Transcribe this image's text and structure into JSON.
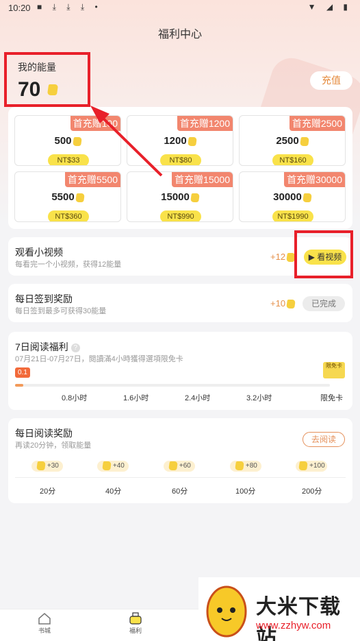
{
  "status_bar": {
    "time": "10:20",
    "left_icons": "■ ⤓ ⤓ ⤓ •",
    "right_icons": "▼ ◢ ▮"
  },
  "header": {
    "title": "福利中心"
  },
  "energy": {
    "label": "我的能量",
    "value": "70",
    "recharge_label": "充值"
  },
  "packs": [
    {
      "badge": "首充赠100",
      "amount": "500",
      "price": "NT$33"
    },
    {
      "badge": "首充赠1200",
      "amount": "1200",
      "price": "NT$80"
    },
    {
      "badge": "首充赠2500",
      "amount": "2500",
      "price": "NT$160"
    },
    {
      "badge": "首充赠5500",
      "amount": "5500",
      "price": "NT$360"
    },
    {
      "badge": "首充赠15000",
      "amount": "15000",
      "price": "NT$990"
    },
    {
      "badge": "首充赠30000",
      "amount": "30000",
      "price": "NT$1990"
    }
  ],
  "video_task": {
    "title": "观看小视频",
    "subtitle": "每看完一个小视频，获得12能量",
    "reward": "+12",
    "button": "看视频"
  },
  "checkin_task": {
    "title": "每日签到奖励",
    "subtitle": "每日签到最多可获得30能量",
    "reward": "+10",
    "button": "已完成"
  },
  "week_read": {
    "title": "7日阅读福利",
    "help": "?",
    "subtitle": "07月21日-07月27日，閱讀滿4小時獲得選項限免卡",
    "progress_tag": "0.1",
    "progress": 0.025,
    "ticks": [
      "0.8小时",
      "1.6小时",
      "2.4小时",
      "3.2小时",
      "限免卡"
    ],
    "card_icon_text": "限免卡"
  },
  "daily_read": {
    "title": "每日阅读奖励",
    "subtitle": "再读20分钟，领取能量",
    "button": "去阅读",
    "bonuses": [
      "+30",
      "+40",
      "+60",
      "+80",
      "+100"
    ],
    "minutes": [
      "20分",
      "40分",
      "60分",
      "100分",
      "200分"
    ]
  },
  "bottom_nav": {
    "items": [
      "书城",
      "福利"
    ]
  },
  "watermark": {
    "title": "大米下载站",
    "url": "www.zzhyw.com"
  },
  "colors": {
    "accent": "#e8202a",
    "gold": "#f9e24a",
    "badge": "#f2866e"
  }
}
